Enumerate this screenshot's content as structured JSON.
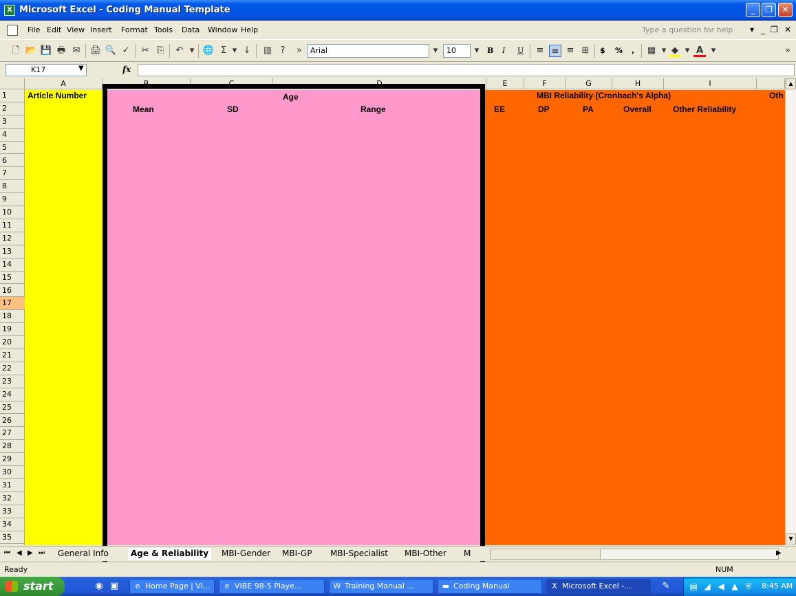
{
  "window": {
    "title": "Microsoft Excel - Coding Manual Template"
  },
  "menu": [
    "File",
    "Edit",
    "View",
    "Insert",
    "Format",
    "Tools",
    "Data",
    "Window",
    "Help"
  ],
  "help_placeholder": "Type a question for help",
  "toolbar": {
    "font": "Arial",
    "size": "10",
    "bold": "B",
    "italic": "I",
    "underline": "U",
    "currency": "$",
    "percent": "%",
    "comma": ","
  },
  "formula_bar": {
    "name_box": "K17",
    "fx": "fx",
    "formula": ""
  },
  "columns": [
    "A",
    "B",
    "C",
    "D",
    "E",
    "F",
    "G",
    "H",
    "I"
  ],
  "rows": [
    "1",
    "2",
    "3",
    "4",
    "5",
    "6",
    "7",
    "8",
    "9",
    "10",
    "11",
    "12",
    "13",
    "14",
    "15",
    "16",
    "17",
    "18",
    "19",
    "20",
    "21",
    "22",
    "23",
    "24",
    "25",
    "26",
    "27",
    "28",
    "29",
    "30",
    "31",
    "32",
    "33",
    "34",
    "35"
  ],
  "selected_row": "17",
  "cells": {
    "a1": "Article Number",
    "age_header": "Age",
    "mean": "Mean",
    "sd": "SD",
    "range": "Range",
    "mbi_header": "MBI Reliability (Cronbach's Alpha)",
    "other_trunc": "Oth",
    "ee": "EE",
    "dp": "DP",
    "pa": "PA",
    "overall": "Overall",
    "other_reliability": "Other Reliability"
  },
  "colors": {
    "yellow": "#ffff00",
    "pink": "#ff99cc",
    "orange": "#ff6600"
  },
  "sheet_tabs": [
    "General Info",
    "Age & Reliability",
    "MBI-Gender",
    "MBI-GP",
    "MBI-Specialist",
    "MBI-Other",
    "M"
  ],
  "active_tab": "Age & Reliability",
  "status": {
    "left": "Ready",
    "num": "NUM"
  },
  "taskbar": {
    "start": "start",
    "tasks": [
      "Home Page | VI...",
      "VIBE 98-5 Playe...",
      "Training Manual ...",
      "Coding Manual",
      "Microsoft Excel -..."
    ],
    "clock": "8:45 AM"
  }
}
